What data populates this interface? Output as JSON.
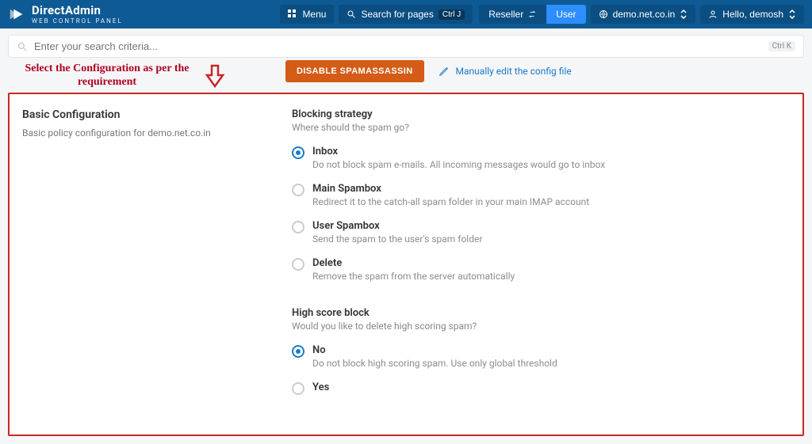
{
  "brand": {
    "title": "DirectAdmin",
    "subtitle": "web control panel"
  },
  "topbar": {
    "menu_label": "Menu",
    "search_pages_label": "Search for pages",
    "search_pages_kbd": "Ctrl J",
    "role_reseller": "Reseller",
    "role_user": "User",
    "domain_label": "demo.net.co.in",
    "hello_label": "Hello, demosh"
  },
  "searchbar": {
    "placeholder": "Enter your search criteria...",
    "kbd": "Ctrl K"
  },
  "callout": {
    "text": "Select the Configuration as per the requirement"
  },
  "actions": {
    "disable_label": "DISABLE SPAMASSASSIN",
    "edit_label": "Manually edit the config file"
  },
  "left": {
    "title": "Basic Configuration",
    "subtitle": "Basic policy configuration for demo.net.co.in"
  },
  "blocking": {
    "title": "Blocking strategy",
    "subtitle": "Where should the spam go?",
    "options": [
      {
        "label": "Inbox",
        "desc": "Do not block spam e-mails. All incoming messages would go to inbox",
        "checked": true
      },
      {
        "label": "Main Spambox",
        "desc": "Redirect it to the catch-all spam folder in your main IMAP account",
        "checked": false
      },
      {
        "label": "User Spambox",
        "desc": "Send the spam to the user's spam folder",
        "checked": false
      },
      {
        "label": "Delete",
        "desc": "Remove the spam from the server automatically",
        "checked": false
      }
    ]
  },
  "highscore": {
    "title": "High score block",
    "subtitle": "Would you like to delete high scoring spam?",
    "options": [
      {
        "label": "No",
        "desc": "Do not block high scoring spam. Use only global threshold",
        "checked": true
      },
      {
        "label": "Yes",
        "desc": "",
        "checked": false
      }
    ]
  }
}
